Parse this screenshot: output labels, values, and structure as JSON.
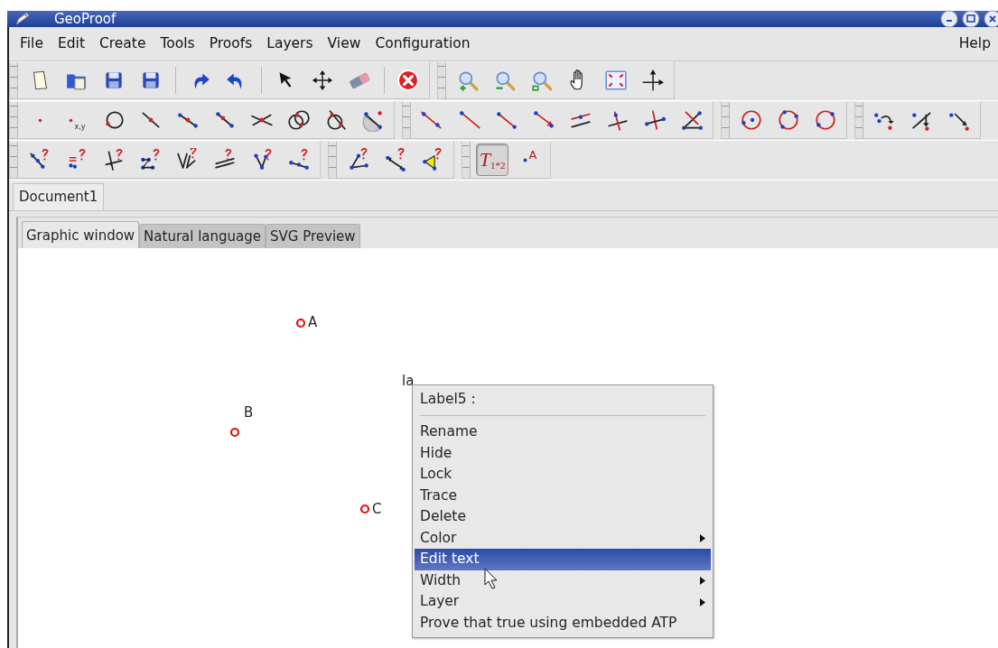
{
  "window": {
    "title": "GeoProof"
  },
  "menu_bar": {
    "left": [
      "File",
      "Edit",
      "Create",
      "Tools",
      "Proofs",
      "Layers",
      "View",
      "Configuration"
    ],
    "right": [
      "Help"
    ]
  },
  "toolbar_rows": [
    [
      {
        "buttons": [
          {
            "kind": "button",
            "pressed": false
          },
          {
            "kind": "button",
            "pressed": false
          },
          {
            "kind": "button",
            "pressed": false
          },
          {
            "kind": "button",
            "pressed": false
          },
          {
            "kind": "separator"
          },
          {
            "kind": "button",
            "pressed": false
          },
          {
            "kind": "button",
            "pressed": false
          },
          {
            "kind": "separator"
          },
          {
            "kind": "button",
            "pressed": false
          },
          {
            "kind": "button",
            "pressed": false
          },
          {
            "kind": "button",
            "pressed": false
          },
          {
            "kind": "separator"
          },
          {
            "kind": "button",
            "pressed": false
          }
        ]
      },
      {
        "buttons": [
          {
            "kind": "button",
            "pressed": false
          },
          {
            "kind": "button",
            "pressed": false
          },
          {
            "kind": "button",
            "pressed": false
          },
          {
            "kind": "button",
            "pressed": false
          },
          {
            "kind": "button",
            "pressed": false
          },
          {
            "kind": "button",
            "pressed": false
          }
        ]
      }
    ],
    [
      {
        "buttons": [
          {
            "kind": "button",
            "pressed": false
          },
          {
            "kind": "button",
            "pressed": false,
            "text": "x,y"
          },
          {
            "kind": "button",
            "pressed": false
          },
          {
            "kind": "button",
            "pressed": false
          },
          {
            "kind": "button",
            "pressed": false
          },
          {
            "kind": "button",
            "pressed": false
          },
          {
            "kind": "button",
            "pressed": false
          },
          {
            "kind": "button",
            "pressed": false
          },
          {
            "kind": "button",
            "pressed": false
          },
          {
            "kind": "button",
            "pressed": false
          }
        ]
      },
      {
        "buttons": [
          {
            "kind": "button",
            "pressed": false
          },
          {
            "kind": "button",
            "pressed": false
          },
          {
            "kind": "button",
            "pressed": false
          },
          {
            "kind": "button",
            "pressed": false
          },
          {
            "kind": "button",
            "pressed": false
          },
          {
            "kind": "button",
            "pressed": false
          },
          {
            "kind": "button",
            "pressed": false
          },
          {
            "kind": "button",
            "pressed": false
          }
        ]
      },
      {
        "buttons": [
          {
            "kind": "button",
            "pressed": false
          },
          {
            "kind": "button",
            "pressed": false
          },
          {
            "kind": "button",
            "pressed": false
          }
        ]
      },
      {
        "buttons": [
          {
            "kind": "button",
            "pressed": false
          },
          {
            "kind": "button",
            "pressed": false
          },
          {
            "kind": "button",
            "pressed": false
          }
        ]
      }
    ],
    [
      {
        "buttons": [
          {
            "kind": "button",
            "pressed": false
          },
          {
            "kind": "button",
            "pressed": false
          },
          {
            "kind": "button",
            "pressed": false
          },
          {
            "kind": "button",
            "pressed": false
          },
          {
            "kind": "button",
            "pressed": false
          },
          {
            "kind": "button",
            "pressed": false
          },
          {
            "kind": "button",
            "pressed": false
          },
          {
            "kind": "button",
            "pressed": false
          }
        ]
      },
      {
        "buttons": [
          {
            "kind": "button",
            "pressed": false
          },
          {
            "kind": "button",
            "pressed": false
          },
          {
            "kind": "button",
            "pressed": false
          }
        ]
      },
      {
        "buttons": [
          {
            "kind": "button",
            "pressed": true,
            "text": "T$_{1*2}$"
          },
          {
            "kind": "button",
            "pressed": false,
            "text": "A"
          }
        ]
      }
    ]
  ],
  "document_tabs": [
    {
      "label": "Document1",
      "selected": true
    }
  ],
  "view_tabs": [
    {
      "label": "Graphic window",
      "selected": true
    },
    {
      "label": "Natural language",
      "selected": false
    },
    {
      "label": "SVG Preview",
      "selected": false
    }
  ],
  "canvas": {
    "points": [
      {
        "label": "A"
      },
      {
        "label": "B"
      },
      {
        "label": "C"
      }
    ],
    "texts": [
      {
        "text": "la"
      }
    ]
  },
  "context_menu": {
    "title": "Label5 :",
    "items": [
      {
        "label": "Rename",
        "submenu": false,
        "selected": false
      },
      {
        "label": "Hide",
        "submenu": false,
        "selected": false
      },
      {
        "label": "Lock",
        "submenu": false,
        "selected": false
      },
      {
        "label": "Trace",
        "submenu": false,
        "selected": false
      },
      {
        "label": "Delete",
        "submenu": false,
        "selected": false
      },
      {
        "label": "Color",
        "submenu": true,
        "selected": false
      },
      {
        "label": "Edit text",
        "submenu": false,
        "selected": true
      },
      {
        "label": "Width",
        "submenu": true,
        "selected": false
      },
      {
        "label": "Layer",
        "submenu": true,
        "selected": false
      },
      {
        "label": "Prove that true using embedded ATP",
        "submenu": false,
        "selected": false
      }
    ]
  }
}
